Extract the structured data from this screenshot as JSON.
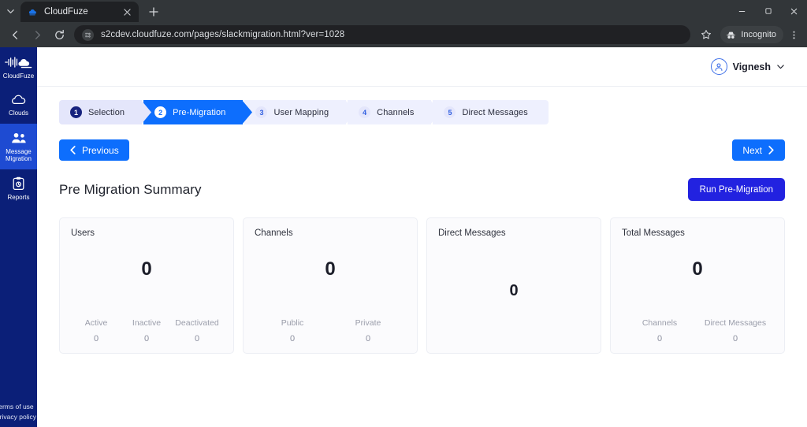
{
  "browser": {
    "tab": {
      "title": "CloudFuze",
      "favicon": "cloudfuze-favicon",
      "close_label": "×"
    },
    "new_tab_label": "+",
    "tab_list_label": "⌄",
    "window_controls": {
      "minimize": "—",
      "maximize": "▢",
      "close": "✕"
    },
    "toolbar": {
      "back_label": "←",
      "forward_label": "→",
      "reload_label": "⟳",
      "url": "s2cdev.cloudfuze.com/pages/slackmigration.html?ver=1028",
      "site_info_icon": "page-info-icon",
      "bookmark_icon": "star-icon",
      "incognito_label": "Incognito",
      "incognito_icon": "incognito-hat-icon",
      "menu_icon": "kebab-menu-icon"
    }
  },
  "sidebar": {
    "brand": {
      "label": "CloudFuze",
      "icon": "cloudfuze-logo-icon"
    },
    "items": [
      {
        "label": "Clouds",
        "icon": "cloud-icon",
        "active": false
      },
      {
        "label": "Message Migration",
        "icon": "users-icon",
        "active": true
      },
      {
        "label": "Reports",
        "icon": "clipboard-icon",
        "active": false
      }
    ],
    "footer_links": [
      "Terms of use",
      "Privacy policy"
    ],
    "active_color": "#1e4bd2",
    "background_color": "#0b1f78"
  },
  "topbar": {
    "user_name": "Vignesh",
    "avatar_icon": "user-avatar-icon",
    "caret_icon": "chevron-down-icon"
  },
  "stepper": {
    "steps": [
      {
        "number": "1",
        "label": "Selection",
        "state": "completed"
      },
      {
        "number": "2",
        "label": "Pre-Migration",
        "state": "active"
      },
      {
        "number": "3",
        "label": "User Mapping",
        "state": "upcoming"
      },
      {
        "number": "4",
        "label": "Channels",
        "state": "upcoming"
      },
      {
        "number": "5",
        "label": "Direct Messages",
        "state": "upcoming"
      }
    ]
  },
  "nav": {
    "previous_label": "Previous",
    "next_label": "Next"
  },
  "page": {
    "title": "Pre Migration Summary",
    "run_button_label": "Run Pre-Migration"
  },
  "cards": [
    {
      "title": "Users",
      "value": "0",
      "layout": "top",
      "sub": [
        {
          "label": "Active",
          "value": "0"
        },
        {
          "label": "Inactive",
          "value": "0"
        },
        {
          "label": "Deactivated",
          "value": "0"
        }
      ]
    },
    {
      "title": "Channels",
      "value": "0",
      "layout": "top",
      "sub": [
        {
          "label": "Public",
          "value": "0"
        },
        {
          "label": "Private",
          "value": "0"
        }
      ]
    },
    {
      "title": "Direct Messages",
      "value": "0",
      "layout": "centered",
      "sub": []
    },
    {
      "title": "Total Messages",
      "value": "0",
      "layout": "top",
      "sub": [
        {
          "label": "Channels",
          "value": "0"
        },
        {
          "label": "Direct Messages",
          "value": "0"
        }
      ]
    }
  ],
  "colors": {
    "primary_blue": "#0d6efd",
    "run_button_blue": "#2222e0",
    "sidebar_navy": "#0b1f78",
    "step_inactive": "#e4e6fb"
  }
}
